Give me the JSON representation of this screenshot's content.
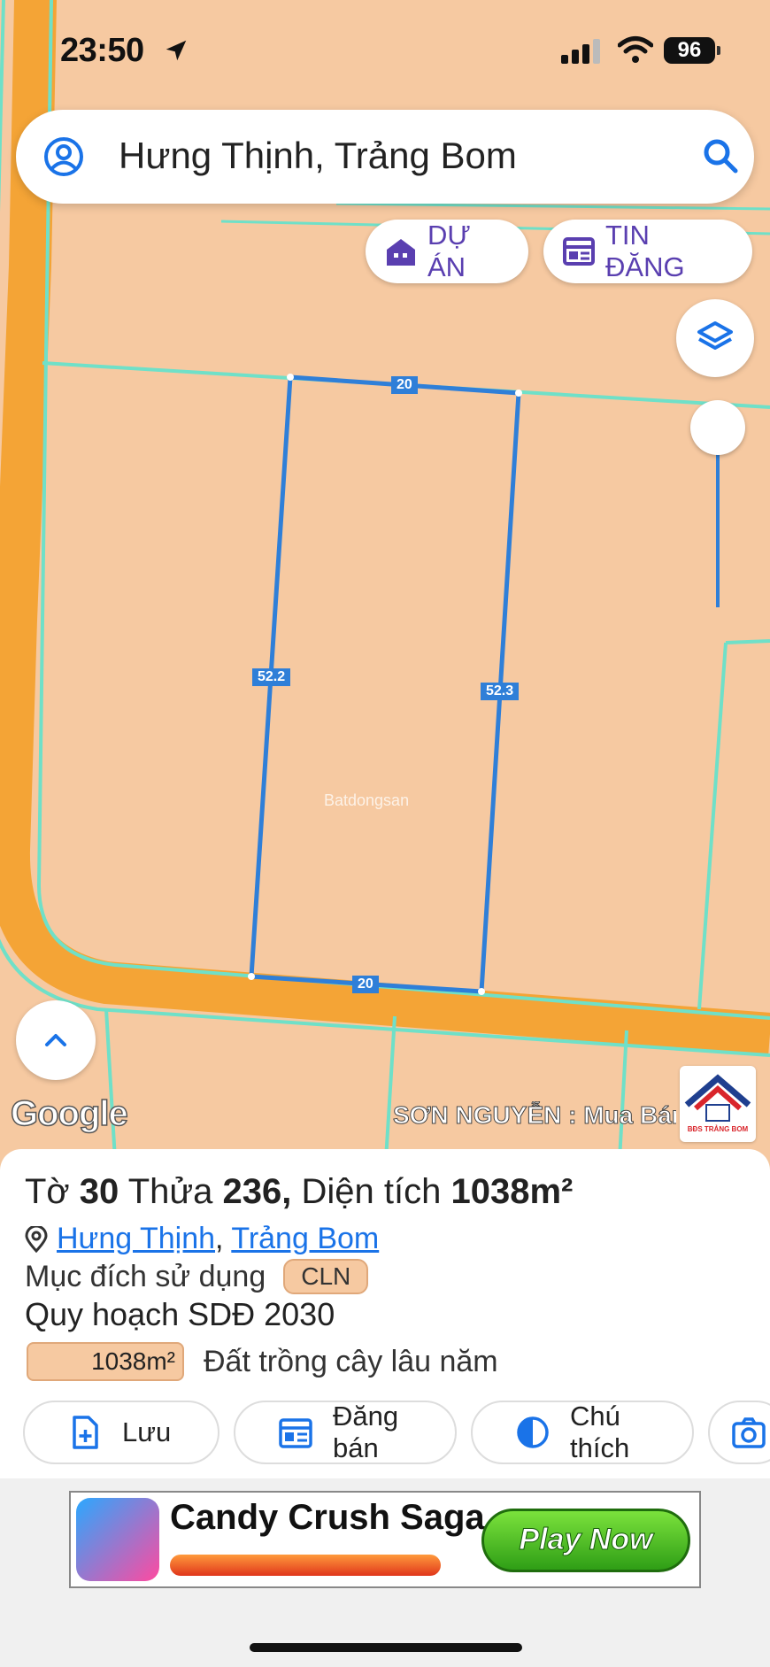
{
  "status_bar": {
    "time": "23:50",
    "battery": "96"
  },
  "search": {
    "query": "Hưng Thịnh, Trảng Bom"
  },
  "chips": {
    "duan_label": "DỰ ÁN",
    "tindang_label": "TIN ĐĂNG"
  },
  "map": {
    "dimensions": {
      "top": "20",
      "bottom": "20",
      "left": "52.2",
      "right": "52.3"
    },
    "google_label": "Google",
    "attribution": "SƠN NGUYỄN : Mua Bán",
    "bds_logo_text": "BĐS TRẢNG BOM",
    "watermark": "Batdongsan"
  },
  "parcel": {
    "to_label": "Tờ",
    "to_value": "30",
    "thua_label": "Thửa",
    "thua_value": "236,",
    "area_label": "Diện tích",
    "area_value": "1038m²",
    "ward": "Hưng Thịnh",
    "separator": ",",
    "district": "Trảng Bom",
    "purpose_label": "Mục đích sử dụng",
    "purpose_code": "CLN",
    "plan_label": "Quy hoạch SDĐ 2030",
    "plan_area": "1038m²",
    "plan_desc": "Đất trồng cây lâu năm"
  },
  "actions": {
    "save": "Lưu",
    "post": "Đăng bán",
    "legend": "Chú thích"
  },
  "ad": {
    "title": "Candy Crush Saga",
    "button": "Play Now"
  },
  "colors": {
    "land": "#f6c9a1",
    "road": "#f4a436",
    "boundary": "#6fe0c8",
    "parcel_line": "#2f7fd8",
    "accent": "#5a3fb0"
  }
}
